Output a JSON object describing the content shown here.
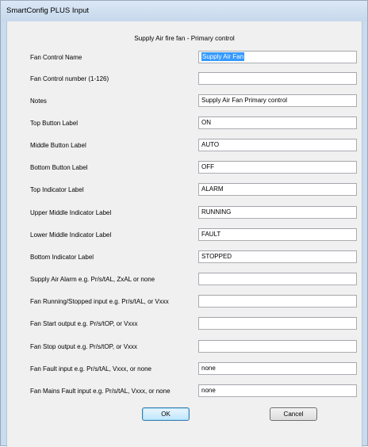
{
  "window": {
    "title": "SmartConfig PLUS Input"
  },
  "form": {
    "subtitle": "Supply Air fire fan - Primary control",
    "fields": [
      {
        "label": "Fan Control Name",
        "value": "Supply Air Fan",
        "selected": true
      },
      {
        "label": "Fan Control number (1-126)",
        "value": ""
      },
      {
        "label": "Notes",
        "value": "Supply Air Fan Primary control"
      },
      {
        "label": "Top Button Label",
        "value": "ON"
      },
      {
        "label": "Middle Button Label",
        "value": "AUTO"
      },
      {
        "label": "Bottom Button Label",
        "value": "OFF"
      },
      {
        "label": "Top Indicator Label",
        "value": "ALARM"
      },
      {
        "label": "Upper Middle Indicator Label",
        "value": "RUNNING"
      },
      {
        "label": "Lower Middle Indicator Label",
        "value": "FAULT"
      },
      {
        "label": "Bottom Indicator Label",
        "value": "STOPPED"
      },
      {
        "label": "Supply Air Alarm e.g. Pr/s/tAL, ZxAL or none",
        "value": ""
      },
      {
        "label": "Fan Running/Stopped input e.g. Pr/s/tAL, or Vxxx",
        "value": ""
      },
      {
        "label": "Fan Start output e.g. Pr/s/tOP, or Vxxx",
        "value": ""
      },
      {
        "label": "Fan Stop output e.g. Pr/s/tOP, or Vxxx",
        "value": ""
      },
      {
        "label": "Fan Fault input e.g. Pr/s/tAL, Vxxx, or none",
        "value": "none"
      },
      {
        "label": "Fan Mains Fault input e.g. Pr/s/tAL, Vxxx, or none",
        "value": "none"
      }
    ]
  },
  "buttons": {
    "ok_label": "OK",
    "cancel_label": "Cancel"
  }
}
